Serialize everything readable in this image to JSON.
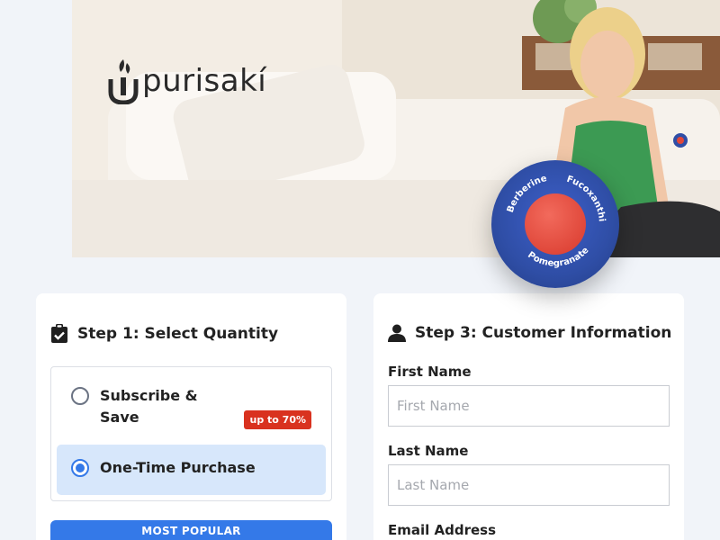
{
  "brand": {
    "name": "purisakí"
  },
  "patch": {
    "ingredients": [
      "Berberine",
      "Fucoxanthin",
      "Pomegranate"
    ]
  },
  "step1": {
    "title": "Step 1: Select Quantity",
    "options": [
      {
        "label_line1": "Subscribe &",
        "label_line2": "Save",
        "badge": "up to 70%",
        "selected": false
      },
      {
        "label": "One-Time Purchase",
        "selected": true
      }
    ],
    "popular_label": "MOST POPULAR"
  },
  "step3": {
    "title": "Step 3: Customer Information",
    "fields": [
      {
        "label": "First Name",
        "placeholder": "First Name"
      },
      {
        "label": "Last Name",
        "placeholder": "Last Name"
      },
      {
        "label": "Email Address"
      }
    ]
  },
  "colors": {
    "accent": "#3479e8",
    "badge": "#d9321f",
    "selected_bg": "#d7e7fb",
    "patch": "#2f4ea6",
    "patch_core": "#e0473a"
  }
}
